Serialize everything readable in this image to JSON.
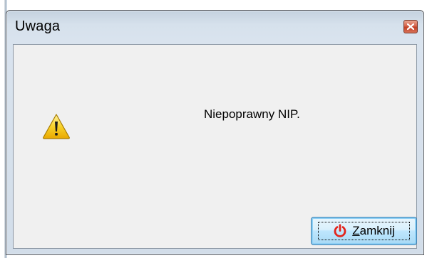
{
  "dialog": {
    "title": "Uwaga",
    "message": "Niepoprawny NIP.",
    "icon": "warning-icon",
    "close_button": {
      "icon": "power-icon",
      "label_accel": "Z",
      "label_rest": "amknij"
    },
    "title_close_icon": "close-icon"
  },
  "colors": {
    "close_button_red": "#c23f24",
    "button_border": "#3c7fb1",
    "power_red": "#e3241b",
    "warning_yellow": "#f5c400"
  }
}
